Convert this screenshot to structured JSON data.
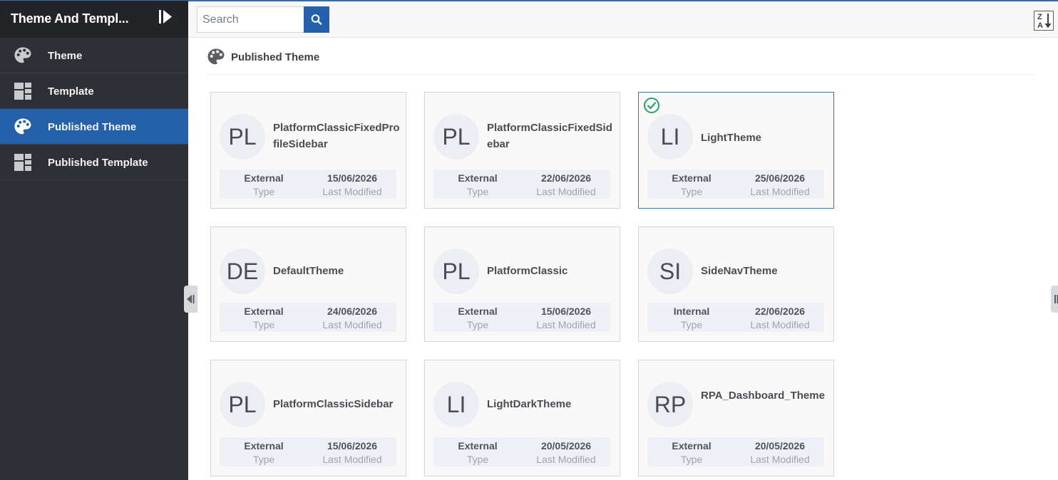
{
  "sidebar": {
    "title": "Theme And Templ...",
    "items": [
      {
        "label": "Theme",
        "icon": "palette-icon"
      },
      {
        "label": "Template",
        "icon": "template-icon"
      },
      {
        "label": "Published Theme",
        "icon": "palette-icon",
        "active": true
      },
      {
        "label": "Published Template",
        "icon": "template-icon"
      }
    ]
  },
  "toolbar": {
    "search_placeholder": "Search",
    "search_value": "",
    "sort_icon": "sort-z-a-icon"
  },
  "section": {
    "title": "Published Theme",
    "icon": "palette-icon"
  },
  "labels": {
    "type": "Type",
    "last_modified": "Last Modified"
  },
  "cards": [
    {
      "initials": "PL",
      "name": "PlatformClassicFixedProfileSidebar",
      "type": "External",
      "modified": "15/06/2026",
      "selected": false
    },
    {
      "initials": "PL",
      "name": "PlatformClassicFixedSidebar",
      "type": "External",
      "modified": "22/06/2026",
      "selected": false
    },
    {
      "initials": "LI",
      "name": "LightTheme",
      "type": "External",
      "modified": "25/06/2026",
      "selected": true
    },
    {
      "initials": "DE",
      "name": "DefaultTheme",
      "type": "External",
      "modified": "24/06/2026",
      "selected": false
    },
    {
      "initials": "PL",
      "name": "PlatformClassic",
      "type": "External",
      "modified": "15/06/2026",
      "selected": false
    },
    {
      "initials": "SI",
      "name": "SideNavTheme",
      "type": "Internal",
      "modified": "22/06/2026",
      "selected": false
    },
    {
      "initials": "PL",
      "name": "PlatformClassicSidebar",
      "type": "External",
      "modified": "15/06/2026",
      "selected": false
    },
    {
      "initials": "LI",
      "name": "LightDarkTheme",
      "type": "External",
      "modified": "20/05/2026",
      "selected": false
    },
    {
      "initials": "RP",
      "name": "RPA_Dashboard_Theme",
      "type": "External",
      "modified": "20/05/2026",
      "selected": false
    }
  ],
  "colors": {
    "accent": "#2560aa",
    "sidebar_bg": "#2f3035",
    "selected_check": "#2f9e6a"
  }
}
